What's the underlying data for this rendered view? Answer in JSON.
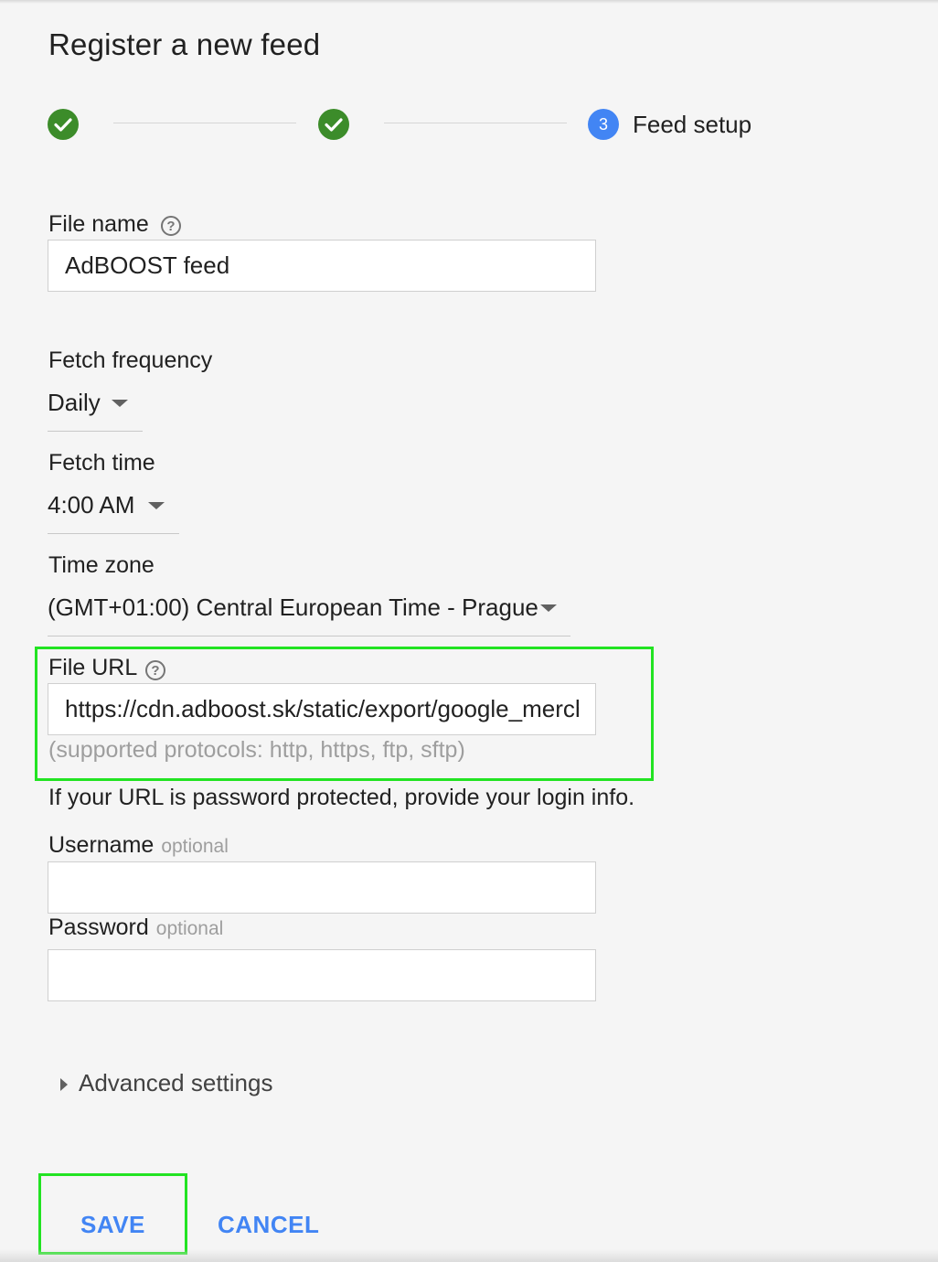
{
  "page": {
    "title": "Register a new feed"
  },
  "stepper": {
    "current_step_number": "3",
    "current_step_label": "Feed setup"
  },
  "form": {
    "file_name": {
      "label": "File name",
      "value": "AdBOOST feed"
    },
    "fetch_frequency": {
      "label": "Fetch frequency",
      "value": "Daily"
    },
    "fetch_time": {
      "label": "Fetch time",
      "value": "4:00 AM"
    },
    "time_zone": {
      "label": "Time zone",
      "value": "(GMT+01:00) Central European Time - Prague"
    },
    "file_url": {
      "label": "File URL",
      "value": "https://cdn.adboost.sk/static/export/google_merchant.xml",
      "hint": "(supported protocols: http, https, ftp, sftp)"
    },
    "password_info": "If your URL is password protected, provide your login info.",
    "username": {
      "label": "Username",
      "optional": "optional",
      "value": ""
    },
    "password": {
      "label": "Password",
      "optional": "optional",
      "value": ""
    },
    "advanced_settings": "Advanced settings"
  },
  "actions": {
    "save": "SAVE",
    "cancel": "CANCEL"
  },
  "colors": {
    "accent": "#4285f4",
    "step_complete": "#3c8c2a",
    "highlight": "#22e322",
    "hint": "#9e9e9e"
  },
  "icons": {
    "step_complete": "check-circle-icon",
    "help": "help-circle-icon",
    "dropdown": "caret-down-icon",
    "expand": "triangle-right-icon"
  }
}
